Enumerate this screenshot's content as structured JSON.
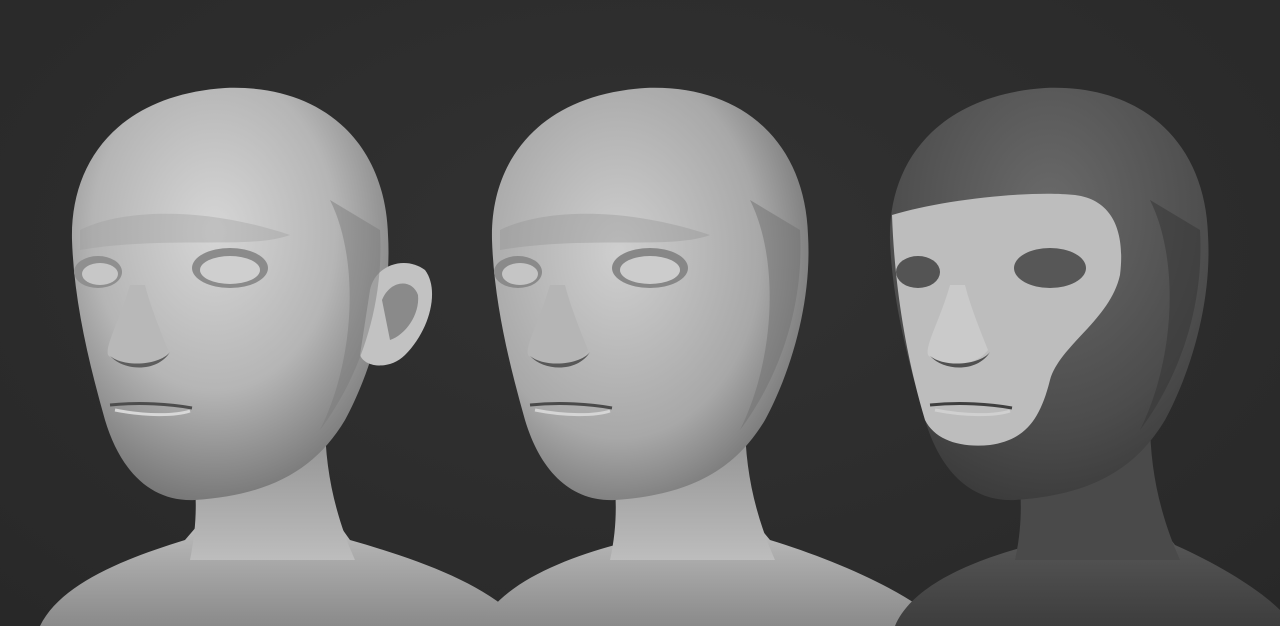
{
  "scene": {
    "background": "#2c2c2c",
    "models": [
      {
        "name": "head-with-ear",
        "shading": "uniform-gray",
        "has_ear": true
      },
      {
        "name": "head-without-ear",
        "shading": "uniform-gray",
        "has_ear": false
      },
      {
        "name": "head-masked",
        "shading": "mask-polygroup",
        "has_ear": false
      }
    ],
    "colors": {
      "skin_light": "#c9c9c9",
      "skin_mid": "#a9a9a9",
      "skin_dark": "#6f6f6f",
      "masked_dark": "#555555"
    }
  }
}
